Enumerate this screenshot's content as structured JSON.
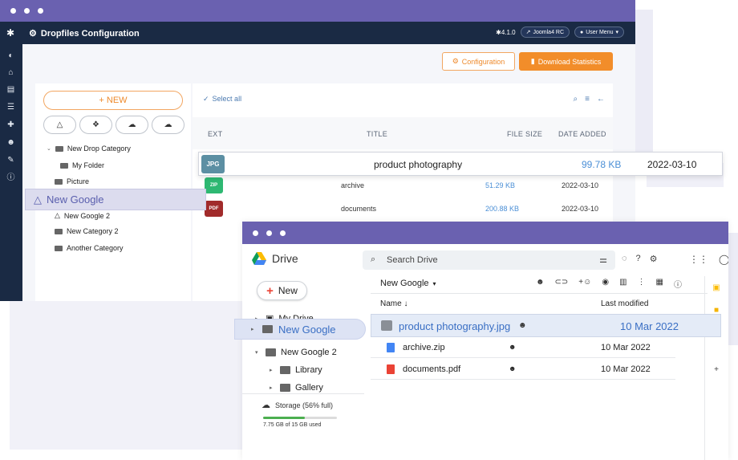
{
  "joomla": {
    "app_title": "Dropfiles Configuration",
    "version": "4.1.0",
    "site_label": "Joomla4 RC",
    "user_menu": "User Menu",
    "config_button": "Configuration",
    "download_stats_button": "Download Statistics",
    "new_button": "+ NEW",
    "select_all": "Select all",
    "columns": {
      "ext": "EXT",
      "title": "TITLE",
      "size": "FILE SIZE",
      "date": "DATE ADDED"
    },
    "tree": [
      {
        "label": "New Drop Category",
        "level": 0,
        "caret": "down"
      },
      {
        "label": "My Folder",
        "level": 1
      },
      {
        "label": "Picture",
        "level": 0
      },
      {
        "label": "New Google",
        "level": 0,
        "highlight": true
      },
      {
        "label": "New Google 2",
        "level": 0,
        "icon": "google-drive-icon"
      },
      {
        "label": "New Category 2",
        "level": 0
      },
      {
        "label": "Another Category",
        "level": 0
      }
    ],
    "files": [
      {
        "ext": "JPG",
        "title": "product photography",
        "size": "99.78 KB",
        "date": "2022-03-10",
        "color": "#5c8fa3",
        "highlight": true
      },
      {
        "ext": "ZIP",
        "title": "archive",
        "size": "51.29 KB",
        "date": "2022-03-10",
        "color": "#2eb872"
      },
      {
        "ext": "PDF",
        "title": "documents",
        "size": "200.88 KB",
        "date": "2022-03-10",
        "color": "#a12b2b"
      }
    ]
  },
  "drive": {
    "app_name": "Drive",
    "search_placeholder": "Search Drive",
    "new_button": "New",
    "breadcrumb": "New Google",
    "col_name": "Name ↓",
    "col_modified": "Last modified",
    "tree": {
      "my_drive": "My Drive",
      "new_google": "New Google",
      "new_google_2": "New Google 2",
      "library": "Library",
      "gallery": "Gallery"
    },
    "storage_label": "Storage (56% full)",
    "storage_fraction": 0.56,
    "storage_used": "7.75 GB of 15 GB used",
    "files": [
      {
        "name": "product photography.jpg",
        "modified": "10 Mar 2022",
        "icon": "image-file-icon",
        "highlight": true
      },
      {
        "name": "archive.zip",
        "modified": "10 Mar 2022",
        "icon": "zip-file-icon",
        "color": "#4285f4"
      },
      {
        "name": "documents.pdf",
        "modified": "10 Mar 2022",
        "icon": "pdf-file-icon",
        "color": "#ea4335"
      }
    ]
  },
  "colors": {
    "titlebar": "#6a61b0",
    "joomla_nav": "#1a2a44",
    "accent_orange": "#f28d2a",
    "drive_blue": "#3a6fc4"
  }
}
